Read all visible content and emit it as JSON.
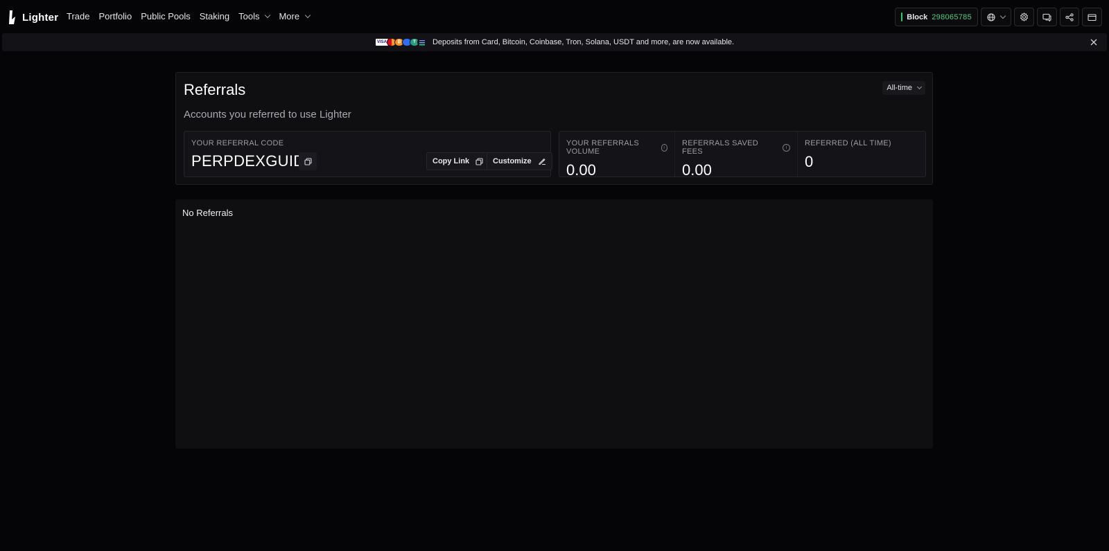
{
  "brand": {
    "name": "Lighter"
  },
  "nav": {
    "items": [
      {
        "label": "Trade"
      },
      {
        "label": "Portfolio"
      },
      {
        "label": "Public Pools"
      },
      {
        "label": "Staking"
      },
      {
        "label": "Tools",
        "dropdown": true
      },
      {
        "label": "More",
        "dropdown": true
      }
    ]
  },
  "header": {
    "block_label": "Block",
    "block_number": "298065785",
    "block_status_color": "#2ecc71"
  },
  "banner": {
    "payment_icons": [
      "VISA",
      "mastercard",
      "bitcoin",
      "coinbase",
      "tron",
      "solana"
    ],
    "visa_label": "VISA",
    "bitcoin_glyph": "₿",
    "tron_glyph": "T",
    "text": "Deposits from Card, Bitcoin, Coinbase, Tron, Solana, USDT and more, are now available."
  },
  "referrals": {
    "title": "Referrals",
    "subtitle": "Accounts you referred to use Lighter",
    "range": "All-time",
    "code_label": "YOUR REFERRAL CODE",
    "code": "PERPDEXGUIDE",
    "copy_link_label": "Copy Link",
    "customize_label": "Customize",
    "stats": [
      {
        "label": "YOUR REFERRALS VOLUME",
        "value": "0.00",
        "info": true
      },
      {
        "label": "REFERRALS SAVED FEES",
        "value": "0.00",
        "info": true
      },
      {
        "label": "REFERRED (ALL TIME)",
        "value": "0",
        "info": false
      }
    ]
  },
  "list": {
    "empty_text": "No Referrals"
  },
  "colors": {
    "accent_green": "#4cd07d",
    "background": "#050507",
    "panel": "#0f0f12"
  }
}
